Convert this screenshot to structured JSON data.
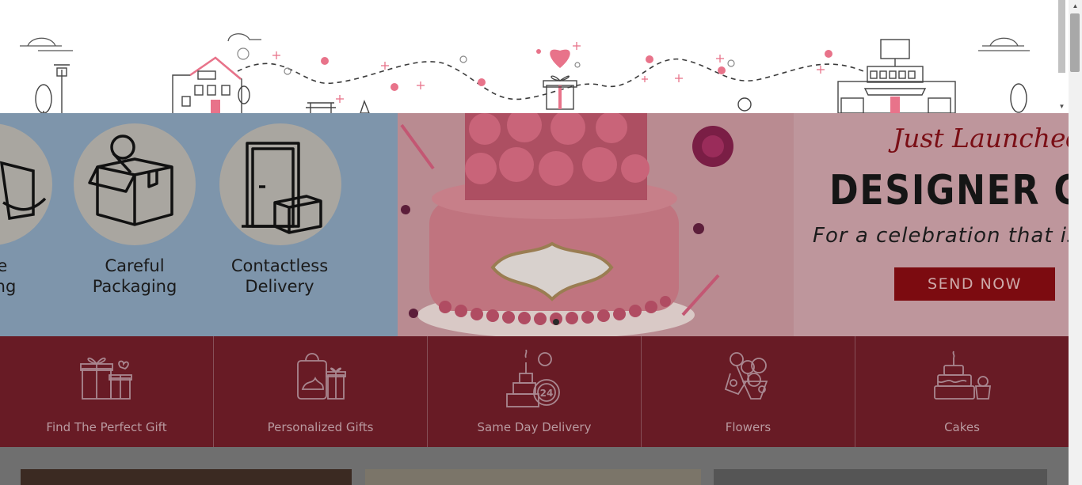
{
  "hero": {
    "features": [
      {
        "line1": "fe",
        "line2": "ling"
      },
      {
        "line1": "Careful",
        "line2": "Packaging"
      },
      {
        "line1": "Contactless",
        "line2": "Delivery"
      }
    ],
    "script_text": "Just Launched",
    "headline": "DESIGNER CAK",
    "subtext": "For a celebration that is",
    "cta_label": "SEND NOW"
  },
  "categories": [
    {
      "label": "Find The Perfect Gift",
      "icon": "gift-boxes-icon"
    },
    {
      "label": "Personalized Gifts",
      "icon": "personalized-bag-icon"
    },
    {
      "label": "Same Day Delivery",
      "icon": "same-day-delivery-24-icon"
    },
    {
      "label": "Flowers",
      "icon": "flower-bouquet-icon"
    },
    {
      "label": "Cakes",
      "icon": "cake-icon"
    }
  ],
  "colors": {
    "category_bar": "#681b25",
    "hero_left": "#7e95ab",
    "cta": "#7c0b10",
    "accent_pink": "#e8738a"
  }
}
